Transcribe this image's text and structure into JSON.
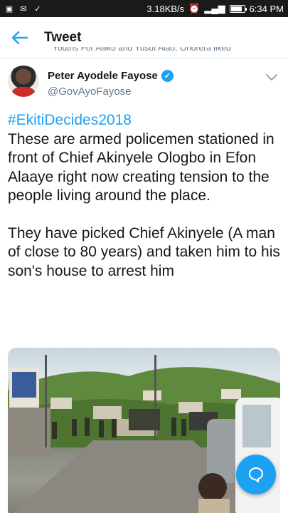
{
  "status_bar": {
    "network_speed": "3.18KB/s",
    "time": "6:34 PM",
    "icons": [
      "notification-icon",
      "mail-icon",
      "check-icon",
      "alarm-icon",
      "signal-icon",
      "battery-icon"
    ],
    "battery_level": 0.85
  },
  "appbar": {
    "back_icon": "arrow-left-icon",
    "title": "Tweet"
  },
  "cutoff_line": "Youths For Alliko and Yusuf Alao, Onorera liked",
  "tweet": {
    "author_name": "Peter Ayodele Fayose",
    "author_handle": "@GovAyoFayose",
    "verified": true,
    "hashtag": "#EkitiDecides2018",
    "paragraph_1": "These are armed policemen stationed in front of Chief Akinyele Ologbo in Efon Alaaye right now creating tension to the people living around the place.",
    "paragraph_2": "They have picked Chief Akinyele (A man of close to 80 years) and taken him to his son's house to arrest him"
  },
  "colors": {
    "accent": "#1da1f2",
    "text": "#14171a",
    "secondary_text": "#657786"
  }
}
